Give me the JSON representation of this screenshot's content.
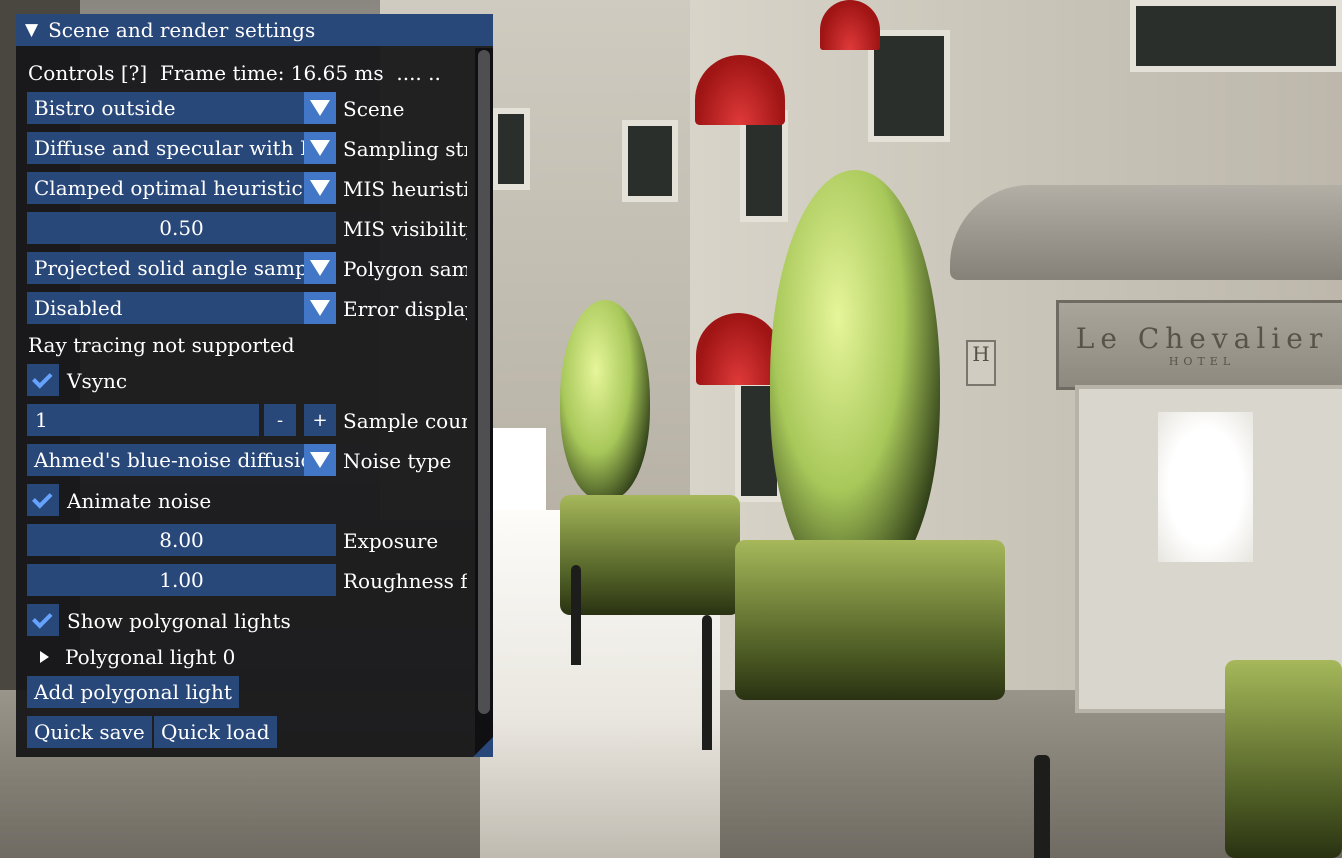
{
  "panel": {
    "title": "Scene and render settings",
    "controls_help": "Controls [?]",
    "frame_time": "Frame time: 16.65 ms",
    "frame_time_graph": ".... ..",
    "scene": {
      "value": "Bistro outside",
      "label": "Scene"
    },
    "sampling_strategy": {
      "value": "Diffuse and specular with MIS",
      "label": "Sampling strategy"
    },
    "mis_heuristic": {
      "value": "Clamped optimal heuristic (c",
      "label": "MIS heuristic"
    },
    "mis_visibility": {
      "value": "0.50",
      "label": "MIS visibility"
    },
    "polygon_sampling": {
      "value": "Projected solid angle sampling",
      "label": "Polygon sampling"
    },
    "error_display": {
      "value": "Disabled",
      "label": "Error display"
    },
    "ray_tracing_status": "Ray tracing not supported",
    "vsync": {
      "label": "Vsync",
      "checked": true
    },
    "sample_count": {
      "value": "1",
      "minus": "-",
      "plus": "+",
      "label": "Sample count"
    },
    "noise_type": {
      "value": "Ahmed's blue-noise diffusion",
      "label": "Noise type"
    },
    "animate_noise": {
      "label": "Animate noise",
      "checked": true
    },
    "exposure": {
      "value": "8.00",
      "label": "Exposure"
    },
    "roughness": {
      "value": "1.00",
      "label": "Roughness factor"
    },
    "show_polygonal_lights": {
      "label": "Show polygonal lights",
      "checked": true
    },
    "polygonal_light_node": "Polygonal light 0",
    "add_polygonal_light": "Add polygonal light",
    "quick_save": "Quick save",
    "quick_load": "Quick load"
  },
  "scene_view": {
    "hotel_sign_main": "Le Chevalier",
    "hotel_sign_sub": "HOTEL",
    "hotel_plaque": "H"
  },
  "colors": {
    "title_bar": "#29487a",
    "frame_bg": "#29487a",
    "button_accent": "#4276c6",
    "check_mark": "#66a3ff",
    "window_bg": "#161618"
  }
}
